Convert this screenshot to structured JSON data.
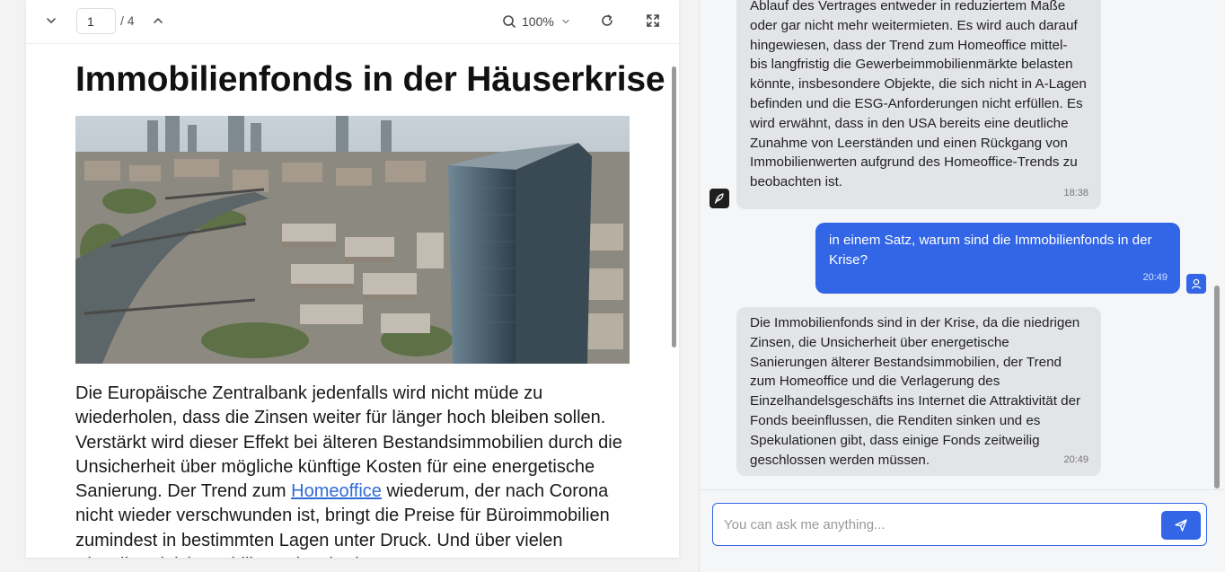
{
  "viewer": {
    "page_current": "1",
    "page_total": "/ 4",
    "zoom": "100%",
    "icons": {
      "prev": "chevron-down-icon",
      "next": "chevron-up-icon",
      "search": "search-icon",
      "zoom_dropdown": "chevron-down-icon",
      "refresh": "refresh-icon",
      "fullscreen": "fullscreen-icon"
    }
  },
  "document": {
    "title": "Immobilienfonds in der Häuserkrise",
    "image": "aerial-city-photo",
    "paragraph_before_link": "Die Europäische Zentralbank jedenfalls wird nicht müde zu wiederholen, dass die Zinsen weiter für länger hoch bleiben sollen. Verstärkt wird dieser Effekt bei älteren Bestandsimmobilien durch die Unsicherheit über mögliche künftige Kosten für eine energetische Sanierung. Der Trend zum ",
    "link": "Homeoffice",
    "paragraph_after_link": " wiederum, der nach Corona nicht wieder verschwunden ist, bringt die Preise für Büroimmobilien zumindest in bestimmten Lagen unter Druck. Und über vielen Einzelhandelsimmobilien schwebt das"
  },
  "chat": {
    "messages": [
      {
        "role": "bot",
        "text": "Ablauf des Vertrages entweder in reduziertem Maße oder gar nicht mehr weitermieten. Es wird auch darauf hingewiesen, dass der Trend zum Homeoffice mittel- bis langfristig die Gewerbeimmobilienmärkte belasten könnte, insbesondere Objekte, die sich nicht in A-Lagen befinden und die ESG-Anforderungen nicht erfüllen. Es wird erwähnt, dass in den USA bereits eine deutliche Zunahme von Leerständen und einen Rückgang von Immobilienwerten aufgrund des Homeoffice-Trends zu beobachten ist.",
        "time": "18:38"
      },
      {
        "role": "user",
        "text": "in einem Satz, warum sind die Immobilienfonds in der Krise?",
        "time": "20:49"
      },
      {
        "role": "bot",
        "text": "Die Immobilienfonds sind in der Krise, da die niedrigen Zinsen, die Unsicherheit über energetische Sanierungen älterer Bestandsimmobilien, der Trend zum Homeoffice und die Verlagerung des Einzelhandelsgeschäfts ins Internet die Attraktivität der Fonds beeinflussen, die Renditen sinken und es Spekulationen gibt, dass einige Fonds zeitweilig geschlossen werden müssen.",
        "time": "20:49"
      }
    ],
    "input_placeholder": "You can ask me anything...",
    "icons": {
      "bot_avatar": "feather-icon",
      "user_avatar": "user-icon",
      "send": "send-icon"
    },
    "colors": {
      "accent": "#3266e6",
      "bot_bubble": "#e3e4e8"
    }
  }
}
